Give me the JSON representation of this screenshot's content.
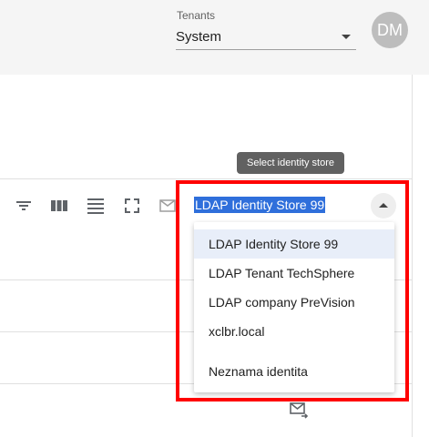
{
  "header": {
    "tenants_label": "Tenants",
    "tenant_value": "System",
    "avatar_initials": "DM"
  },
  "tooltip": {
    "text": "Select identity store"
  },
  "toolbar": {
    "icons": [
      "filter-icon",
      "columns-icon",
      "density-icon",
      "fullscreen-icon",
      "mail-icon"
    ]
  },
  "identity_store": {
    "selected": "LDAP Identity Store 99",
    "options": [
      "LDAP Identity Store 99",
      "LDAP Tenant TechSphere",
      "LDAP company PreVision",
      "xclbr.local",
      "Neznama identita"
    ]
  },
  "colors": {
    "highlight_border": "#ff0000",
    "selection_bg": "#2f6fdb",
    "active_option_bg": "#e8eef9",
    "tooltip_bg": "#616161"
  }
}
